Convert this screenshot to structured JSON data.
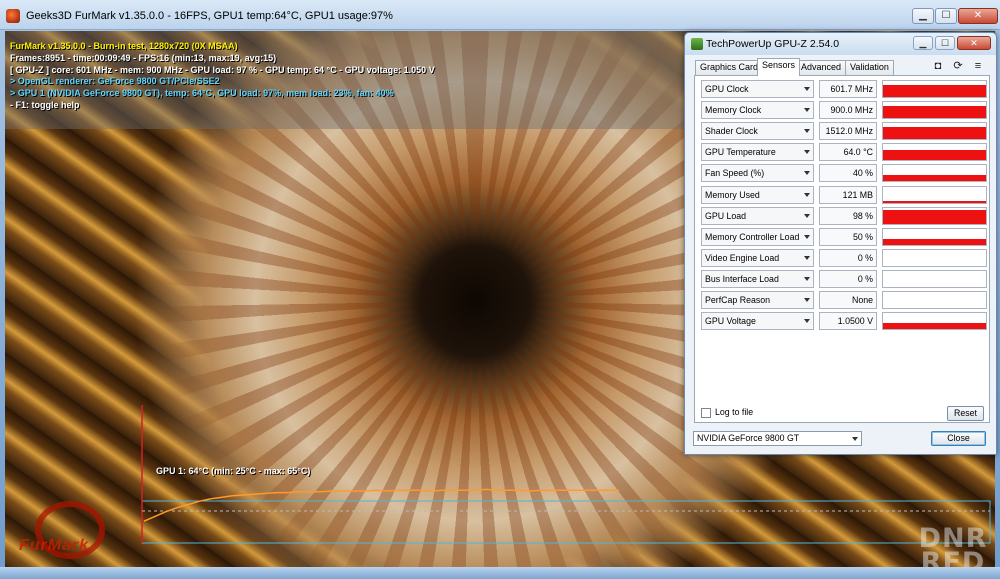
{
  "furmark": {
    "title": "Geeks3D FurMark v1.35.0.0 - 16FPS, GPU1 temp:64°C, GPU1 usage:97%",
    "buttons": {
      "minimize": "▁",
      "maximize": "☐",
      "close": "✕"
    },
    "hud": [
      {
        "text": "FurMark v1.35.0.0 - Burn-in test, 1280x720 (0X MSAA)",
        "color": "yellow"
      },
      {
        "text": "Frames:8951 - time:00:09:49 - FPS:16 (min:13, max:19, avg:15)",
        "color": "white"
      },
      {
        "text": "[ GPU-Z ] core: 601 MHz - mem: 900 MHz - GPU load: 97 % - GPU temp: 64 °C - GPU voltage: 1.050 V",
        "color": "white"
      },
      {
        "text": "> OpenGL renderer: GeForce 9800 GT/PCIe/SSE2",
        "color": "cyan"
      },
      {
        "text": "> GPU 1 (NVIDIA GeForce 9800 GT), temp: 64°C, GPU load: 97%, mem load: 23%, fan: 40%",
        "color": "cyan"
      },
      {
        "text": "- F1: toggle help",
        "color": "white"
      }
    ],
    "graph": {
      "label": "GPU 1: 64°C (min: 25°C - max: 65°C)",
      "min_temp": 25,
      "max_temp": 65,
      "temps": [
        25,
        31,
        37,
        42,
        46,
        50,
        53,
        55,
        57,
        58,
        59,
        60,
        61,
        61,
        62,
        62,
        62,
        63,
        63,
        63,
        63,
        64,
        63,
        64,
        64,
        64,
        63,
        64,
        64,
        64,
        64,
        65,
        64,
        64,
        64,
        63,
        64,
        64,
        64,
        64,
        64,
        64,
        64,
        64
      ]
    },
    "logo_text": "FurMark",
    "colors": {
      "line": "#ff9a2a",
      "axis": "#d62020",
      "frame": "#4fb6d8"
    }
  },
  "watermark": {
    "line1": "DNR",
    "line2": "RED"
  },
  "gpuz": {
    "title": "TechPowerUp GPU-Z 2.54.0",
    "buttons": {
      "minimize": "▁",
      "maximize": "☐",
      "close": "✕"
    },
    "tabs": [
      "Graphics Card",
      "Sensors",
      "Advanced",
      "Validation"
    ],
    "active_tab": "Sensors",
    "tool_icons": [
      "camera-icon",
      "refresh-icon",
      "menu-icon"
    ],
    "tool_glyphs": [
      "◘",
      "⟳",
      "≡"
    ],
    "sensors": [
      {
        "name": "GPU Clock",
        "value": "601.7 MHz",
        "level": 0.72
      },
      {
        "name": "Memory Clock",
        "value": "900.0 MHz",
        "level": 0.72
      },
      {
        "name": "Shader Clock",
        "value": "1512.0 MHz",
        "level": 0.72
      },
      {
        "name": "GPU Temperature",
        "value": "64.0 °C",
        "level": 0.6
      },
      {
        "name": "Fan Speed (%)",
        "value": "40 %",
        "level": 0.35
      },
      {
        "name": "Memory Used",
        "value": "121 MB",
        "level": 0.15
      },
      {
        "name": "GPU Load",
        "value": "98 %",
        "level": 0.85
      },
      {
        "name": "Memory Controller Load",
        "value": "50 %",
        "level": 0.38
      },
      {
        "name": "Video Engine Load",
        "value": "0 %",
        "level": 0
      },
      {
        "name": "Bus Interface Load",
        "value": "0 %",
        "level": 0
      },
      {
        "name": "PerfCap Reason",
        "value": "None",
        "level": 0
      },
      {
        "name": "GPU Voltage",
        "value": "1.0500 V",
        "level": 0.35
      }
    ],
    "log_label": "Log to file",
    "reset_label": "Reset",
    "gpu_select": "NVIDIA GeForce 9800 GT",
    "close_label": "Close",
    "colors": {
      "graph_fill": "#ee1111"
    }
  }
}
